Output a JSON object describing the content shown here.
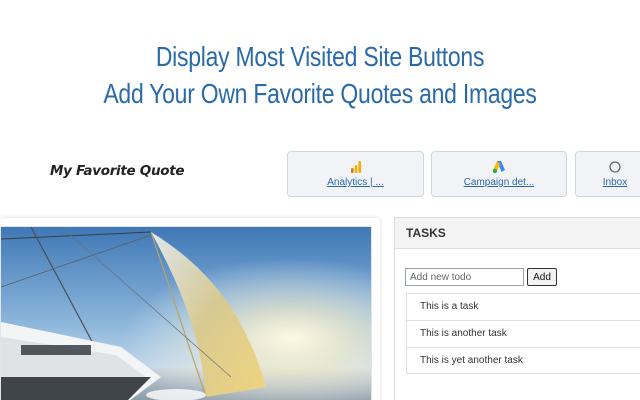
{
  "header": {
    "line1": "Display Most Visited Site Buttons",
    "line2": "Add Your Own Favorite Quotes and Images",
    "color": "#2a6aa6"
  },
  "quote": {
    "title": "My Favorite Quote"
  },
  "sites": [
    {
      "label": "Analytics | ...",
      "icon": "analytics-icon"
    },
    {
      "label": "Campaign det...",
      "icon": "google-ads-icon"
    },
    {
      "label": "Inbox",
      "icon": "inbox-icon"
    }
  ],
  "tasks": {
    "title": "TASKS",
    "input_placeholder": "Add new todo",
    "add_label": "Add",
    "items": [
      {
        "text": "This is a task"
      },
      {
        "text": "This is another task"
      },
      {
        "text": "This is yet another task"
      }
    ]
  }
}
